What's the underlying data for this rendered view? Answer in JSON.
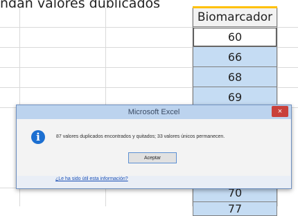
{
  "caption": "ngan valores duplicados",
  "sheet": {
    "column_header": "Biomarcador",
    "rows": [
      "60",
      "66",
      "68",
      "69",
      "",
      "",
      "",
      "",
      "70",
      "77"
    ]
  },
  "dialog": {
    "title": "Microsoft Excel",
    "close_label": "×",
    "message": "87 valores duplicados encontrados y quitados; 33 valores únicos permanecen.",
    "ok_label": "Aceptar",
    "help_link": "¿Le ha sido útil esta información?"
  }
}
